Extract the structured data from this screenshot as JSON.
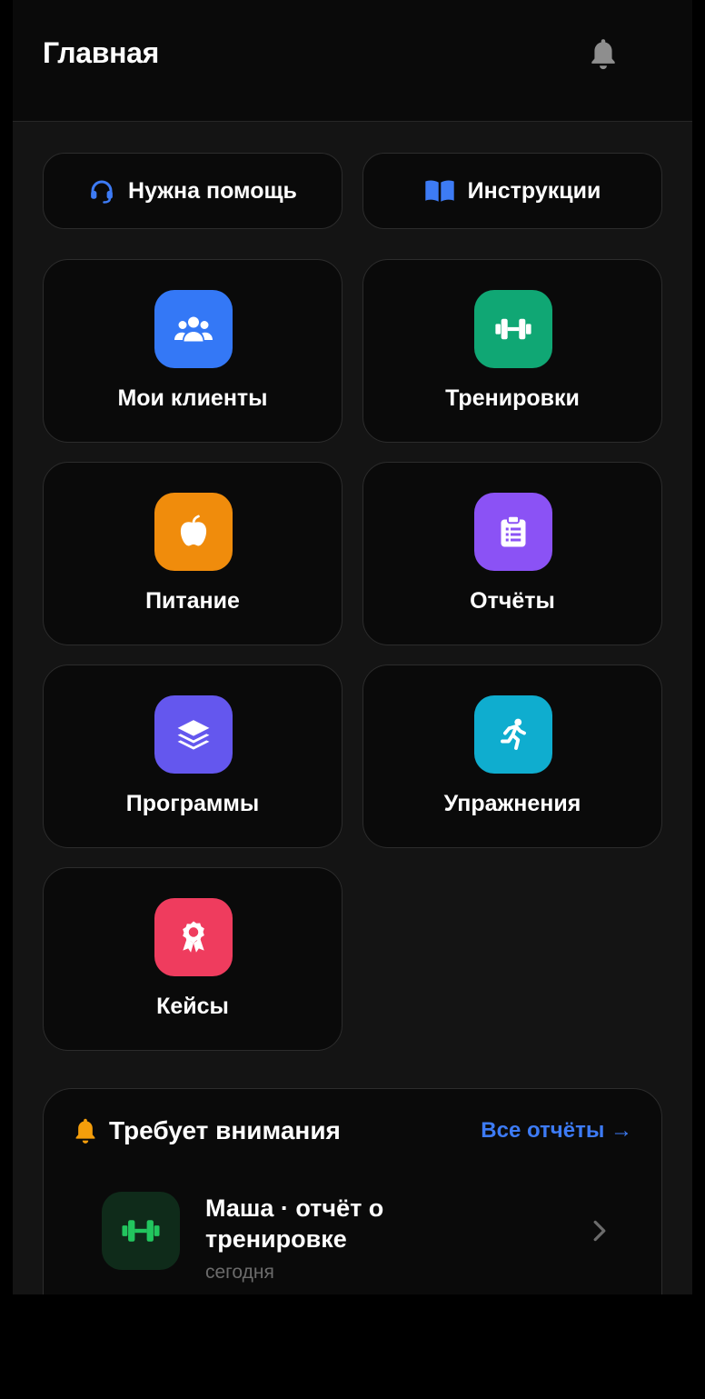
{
  "header": {
    "title": "Главная",
    "icon": "bell-icon"
  },
  "quick_actions": [
    {
      "label": "Нужна помощь",
      "icon": "headset-icon",
      "color": "#3d7bf5"
    },
    {
      "label": "Инструкции",
      "icon": "book-icon",
      "color": "#3d7bf5"
    }
  ],
  "tiles": [
    {
      "label": "Мои клиенты",
      "icon": "users-icon",
      "color": "#3478f6"
    },
    {
      "label": "Тренировки",
      "icon": "dumbbell-icon",
      "color": "#10a774"
    },
    {
      "label": "Питание",
      "icon": "apple-icon",
      "color": "#f08c0c"
    },
    {
      "label": "Отчёты",
      "icon": "clipboard-icon",
      "color": "#8b52f5"
    },
    {
      "label": "Программы",
      "icon": "layers-icon",
      "color": "#6457ee"
    },
    {
      "label": "Упражнения",
      "icon": "running-icon",
      "color": "#0fadcf"
    },
    {
      "label": "Кейсы",
      "icon": "award-icon",
      "color": "#ef3c5e"
    }
  ],
  "attention": {
    "title": "Требует внимания",
    "icon": "bell-icon",
    "icon_color": "#f59e0b",
    "link_label": "Все отчёты →",
    "items": [
      {
        "title": "Маша · отчёт о тренировке",
        "subtitle": "сегодня",
        "icon": "dumbbell-icon",
        "icon_color": "#22c55e"
      }
    ]
  }
}
